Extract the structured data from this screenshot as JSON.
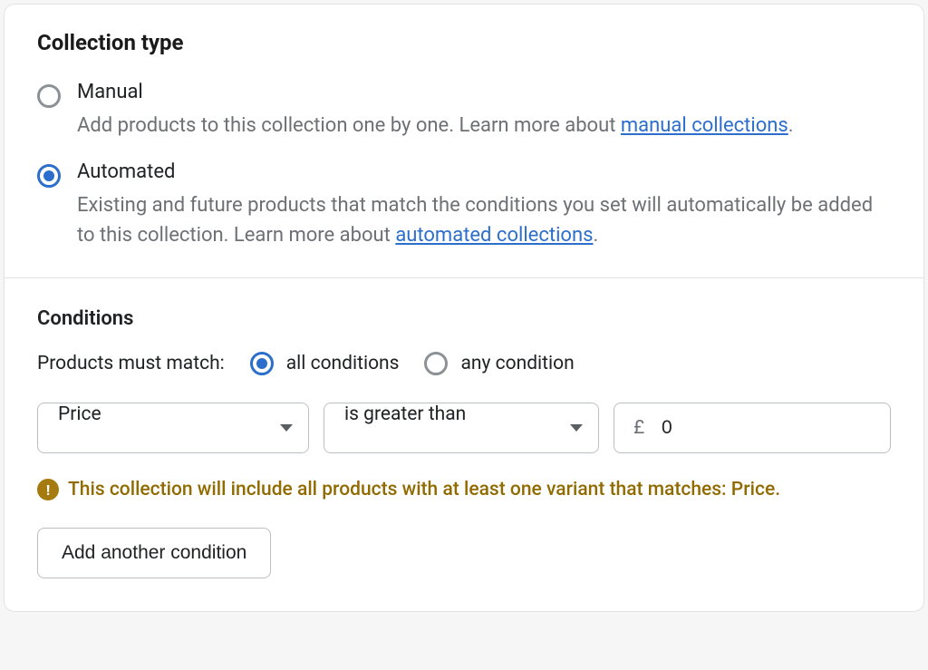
{
  "collectionType": {
    "title": "Collection type",
    "options": {
      "manual": {
        "label": "Manual",
        "descriptionPrefix": "Add products to this collection one by one. Learn more about ",
        "linkText": "manual collections",
        "descriptionSuffix": ".",
        "selected": false
      },
      "automated": {
        "label": "Automated",
        "descriptionPrefix": "Existing and future products that match the conditions you set will automatically be added to this collection. Learn more about ",
        "linkText": "automated collections",
        "descriptionSuffix": ".",
        "selected": true
      }
    }
  },
  "conditions": {
    "title": "Conditions",
    "matchLabel": "Products must match:",
    "matchOptions": {
      "all": {
        "label": "all conditions",
        "selected": true
      },
      "any": {
        "label": "any condition",
        "selected": false
      }
    },
    "row": {
      "field": "Price",
      "operator": "is greater than",
      "currency": "£",
      "value": "0"
    },
    "warning": "This collection will include all products with at least one variant that matches: Price.",
    "addButton": "Add another condition"
  }
}
